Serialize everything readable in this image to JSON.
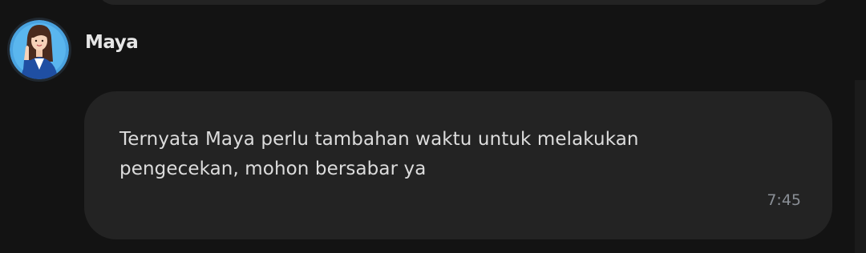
{
  "message": {
    "sender": "Maya",
    "text": "Ternyata Maya perlu tambahan waktu untuk melakukan pengecekan, mohon bersabar ya",
    "time": "7:45"
  },
  "avatar_icon": "woman-agent-avatar",
  "colors": {
    "background": "#131313",
    "bubble": "#232323",
    "text": "#dcdcdc",
    "timestamp": "#8a8f96",
    "avatar_ring": "#4aa3e0"
  }
}
